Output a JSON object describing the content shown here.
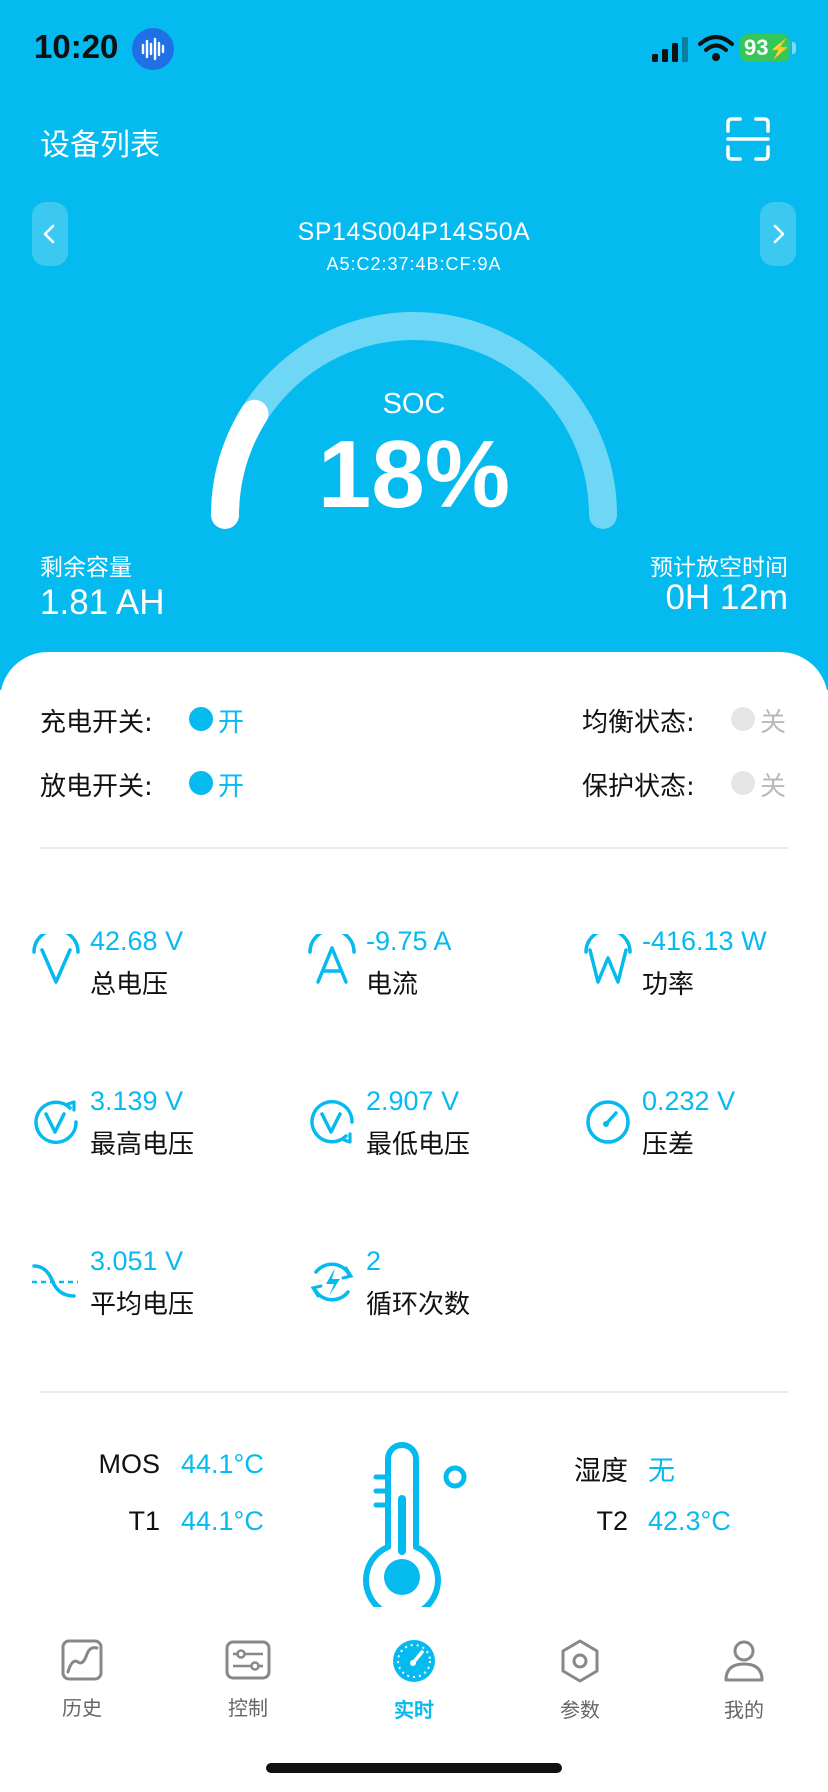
{
  "status_bar": {
    "time": "10:20",
    "battery": "93"
  },
  "header": {
    "title": "设备列表"
  },
  "device": {
    "name": "SP14S004P14S50A",
    "mac": "A5:C2:37:4B:CF:9A"
  },
  "soc": {
    "label": "SOC",
    "value": "18%",
    "percent": 18
  },
  "remaining": {
    "label": "剩余容量",
    "value": "1.81 AH"
  },
  "runtime": {
    "label": "预计放空时间",
    "value": "0H 12m"
  },
  "switches": {
    "charge": {
      "label": "充电开关:",
      "state": "开"
    },
    "discharge": {
      "label": "放电开关:",
      "state": "开"
    },
    "balance": {
      "label": "均衡状态:",
      "state": "关"
    },
    "protect": {
      "label": "保护状态:",
      "state": "关"
    }
  },
  "metrics": {
    "total_voltage": {
      "value": "42.68 V",
      "label": "总电压"
    },
    "current": {
      "value": "-9.75 A",
      "label": "电流"
    },
    "power": {
      "value": "-416.13 W",
      "label": "功率"
    },
    "max_voltage": {
      "value": "3.139 V",
      "label": "最高电压"
    },
    "min_voltage": {
      "value": "2.907 V",
      "label": "最低电压"
    },
    "diff": {
      "value": "0.232 V",
      "label": "压差"
    },
    "avg_voltage": {
      "value": "3.051 V",
      "label": "平均电压"
    },
    "cycles": {
      "value": "2",
      "label": "循环次数"
    }
  },
  "temps": {
    "mos": {
      "label": "MOS",
      "value": "44.1°C"
    },
    "t1": {
      "label": "T1",
      "value": "44.1°C"
    },
    "humidity": {
      "label": "湿度",
      "value": "无"
    },
    "t2": {
      "label": "T2",
      "value": "42.3°C"
    }
  },
  "tabs": [
    {
      "label": "历史",
      "icon": "chart-icon"
    },
    {
      "label": "控制",
      "icon": "sliders-icon"
    },
    {
      "label": "实时",
      "icon": "gauge-icon"
    },
    {
      "label": "参数",
      "icon": "hex-nut-icon"
    },
    {
      "label": "我的",
      "icon": "person-icon"
    }
  ],
  "colors": {
    "brand": "#05baee",
    "active": "#05baee",
    "inactive": "#666666"
  }
}
